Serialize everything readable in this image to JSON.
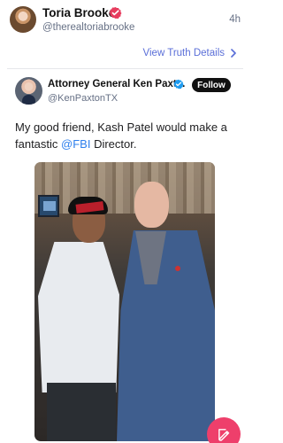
{
  "post": {
    "author_name": "Toria Brooke",
    "handle": "@therealtoriabrooke",
    "time": "4h",
    "view_truth_details": "View Truth Details",
    "verified_icon": "verified-check-icon"
  },
  "quoted_post": {
    "author_name": "Attorney General Ken Paxt...",
    "handle": "@KenPaxtonTX",
    "follow_label": "Follow",
    "text_before": "My good friend, Kash Patel would make a fantastic ",
    "mention": "@FBI",
    "text_after": " Director.",
    "verified_icon": "verified-check-icon",
    "image_icon": "photo"
  },
  "compose_button": {
    "icon": "compose-icon"
  },
  "colors": {
    "verified_red": "#e73c5e",
    "verified_blue": "#1d9bf0",
    "link": "#5b6fd8",
    "mention": "#2f80ed",
    "fab": "#ee3f6b"
  }
}
